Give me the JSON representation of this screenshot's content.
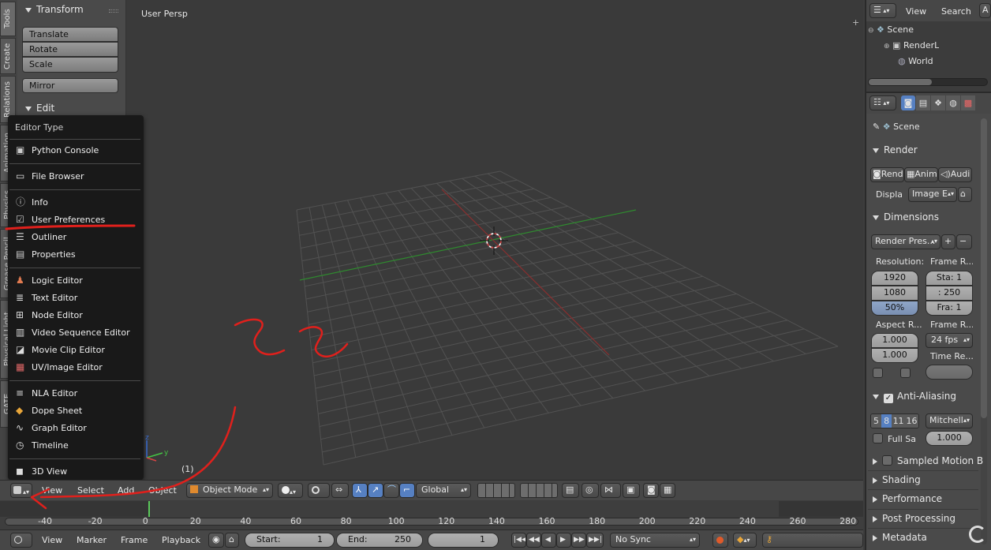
{
  "viewport": {
    "label": "User Persp",
    "frame_label": "(1)"
  },
  "tool_tabs": [
    "Tools",
    "Create",
    "Relations",
    "Animation",
    "Physics",
    "Grease Pencil",
    "Physical Light",
    "GATE"
  ],
  "tools": {
    "transform_header": "Transform",
    "translate": "Translate",
    "rotate": "Rotate",
    "scale": "Scale",
    "mirror": "Mirror",
    "edit_header": "Edit"
  },
  "editor_menu": {
    "title": "Editor Type",
    "items": [
      {
        "label": "Python Console",
        "icon": "console-icon"
      },
      {
        "label": "File Browser",
        "icon": "folder-icon"
      },
      {
        "label": "Info",
        "icon": "info-icon"
      },
      {
        "label": "User Preferences",
        "icon": "preferences-icon"
      },
      {
        "label": "Outliner",
        "icon": "outliner-icon"
      },
      {
        "label": "Properties",
        "icon": "properties-icon"
      },
      {
        "label": "Logic Editor",
        "icon": "logic-icon"
      },
      {
        "label": "Text Editor",
        "icon": "text-icon"
      },
      {
        "label": "Node Editor",
        "icon": "node-icon"
      },
      {
        "label": "Video Sequence Editor",
        "icon": "sequence-icon"
      },
      {
        "label": "Movie Clip Editor",
        "icon": "clip-icon"
      },
      {
        "label": "UV/Image Editor",
        "icon": "image-icon"
      },
      {
        "label": "NLA Editor",
        "icon": "nla-icon"
      },
      {
        "label": "Dope Sheet",
        "icon": "dopesheet-icon"
      },
      {
        "label": "Graph Editor",
        "icon": "graph-icon"
      },
      {
        "label": "Timeline",
        "icon": "timeline-icon"
      },
      {
        "label": "3D View",
        "icon": "view3d-icon"
      }
    ]
  },
  "view_header": {
    "view": "View",
    "select": "Select",
    "add": "Add",
    "object": "Object",
    "mode": "Object Mode",
    "orientation": "Global"
  },
  "timeline_ruler": [
    "-40",
    "-20",
    "0",
    "20",
    "40",
    "60",
    "80",
    "100",
    "120",
    "140",
    "160",
    "180",
    "200",
    "220",
    "240",
    "260",
    "280"
  ],
  "timeline_header": {
    "view": "View",
    "marker": "Marker",
    "frame": "Frame",
    "playback": "Playback",
    "start_label": "Start:",
    "start_value": "1",
    "end_label": "End:",
    "end_value": "250",
    "current": "1",
    "sync": "No Sync"
  },
  "outliner": {
    "view": "View",
    "search": "Search",
    "all": "A",
    "items": [
      "Scene",
      "RenderL",
      "World"
    ]
  },
  "properties": {
    "context": "Scene",
    "render_header": "Render",
    "render_btns": [
      "Rend",
      "Anim",
      "Audi"
    ],
    "display_label": "Displa",
    "display_value": "Image E",
    "dimensions_header": "Dimensions",
    "render_presets": "Render Pres...",
    "resolution_label": "Resolution:",
    "frame_range_label": "Frame R...",
    "res_x": "1920",
    "res_y": "1080",
    "res_pct": "50%",
    "start": "Sta: 1",
    "end": ": 250",
    "step": "Fra: 1",
    "aspect_label": "Aspect R...",
    "frame_rate_label": "Frame R...",
    "aspect_x": "1.000",
    "aspect_y": "1.000",
    "fps": "24 fps",
    "time_remap_label": "Time Re...",
    "aa_header": "Anti-Aliasing",
    "aa_samples": [
      "5",
      "8",
      "11",
      "16"
    ],
    "aa_filter": "Mitchell",
    "full_sample": "Full Sa",
    "aa_size": "1.000",
    "sampled_motion": "Sampled Motion B",
    "shading": "Shading",
    "performance": "Performance",
    "post_processing": "Post Processing",
    "metadata": "Metadata"
  }
}
